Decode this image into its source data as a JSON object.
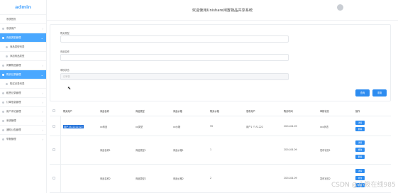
{
  "app": {
    "logo": "admin",
    "header_title": "欢迎使用Unishare闲置物品共享系统"
  },
  "sidebar": {
    "items": [
      {
        "label": "系统首页"
      },
      {
        "label": "系统用户"
      },
      {
        "label": "商品类型管理"
      },
      {
        "label": "商品类型列表"
      },
      {
        "label": "添加商品类型"
      },
      {
        "label": "闲置物品管理"
      },
      {
        "label": "购买记录管理"
      },
      {
        "label": "购买记录列表"
      },
      {
        "label": "租赁记录管理"
      },
      {
        "label": "订单信息管理"
      },
      {
        "label": "用户评论管理"
      },
      {
        "label": "系统管理"
      },
      {
        "label": "通知公告管理"
      },
      {
        "label": "举报管理"
      }
    ]
  },
  "form": {
    "fields": [
      {
        "label": "购买类型",
        "value": ""
      },
      {
        "label": "商品名称",
        "value": ""
      },
      {
        "label": "审核状态",
        "placeholder": "已审核"
      }
    ],
    "search_label": "查询",
    "reset_label": "重置"
  },
  "table": {
    "headers": [
      "购买用户",
      "商品名称",
      "商品类型",
      "商品价格",
      "购买价格",
      "发布用户",
      "购买时间",
      "审核状态",
      "操作"
    ],
    "rows": [
      {
        "cells": [
          "用户1522222222",
          "xx商品",
          "xx类型",
          "xx价格",
          "99",
          "用户1 个人1222",
          "2024-04-09",
          "xxx状态",
          ""
        ],
        "ops": [
          "详情",
          "删除"
        ]
      },
      {
        "cells": [
          "",
          "商品名称1",
          "商品类型1",
          "商品价格1",
          "1",
          "",
          "2024-04-09",
          "发布状态1",
          ""
        ],
        "ops": [
          "详情",
          "修改",
          "删除"
        ]
      },
      {
        "cells": [
          "",
          "商品名称2",
          "商品类型2",
          "商品价格2",
          "2",
          "",
          "2024-04-09",
          "发布状态2",
          ""
        ],
        "ops": [
          "详情",
          "修改",
          "删除"
        ]
      }
    ]
  },
  "watermark": "CSDN @小筱在线985",
  "colors": {
    "accent": "#4aa8ff",
    "button": "#2d8cf0",
    "logo": "#53a9ff",
    "selection": "#1e6fd9"
  }
}
